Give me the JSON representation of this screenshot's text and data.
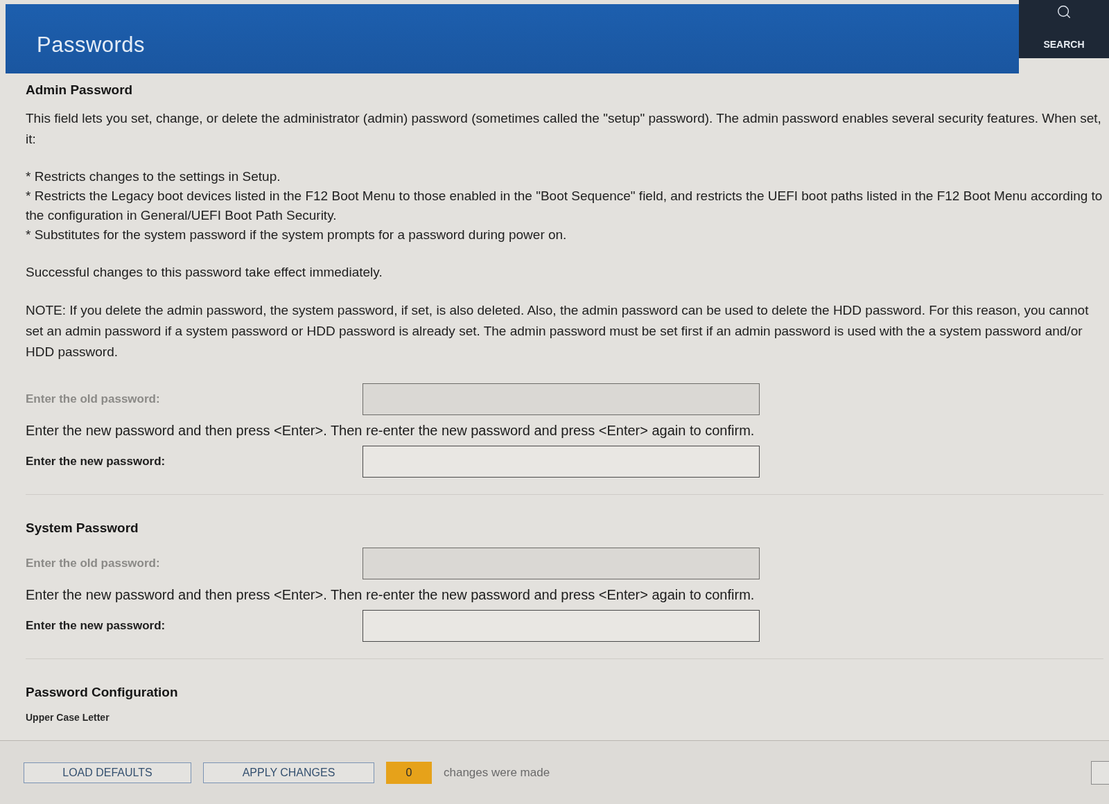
{
  "header": {
    "title": "Passwords",
    "search_label": "SEARCH"
  },
  "sections": [
    {
      "heading": "Admin Password",
      "blocks": [
        {
          "kind": "paragraph",
          "text": "This field lets you set, change, or delete the administrator (admin) password (sometimes called the \"setup\" password). The admin password enables several security features. When set, it:"
        },
        {
          "kind": "bullets",
          "items": [
            "* Restricts changes to the settings in Setup.",
            "* Restricts the Legacy boot devices listed in the F12 Boot Menu to those enabled in the \"Boot Sequence\" field, and restricts the UEFI boot paths listed in the F12 Boot Menu according to the configuration in General/UEFI Boot Path Security.",
            "* Substitutes for the system password if the system prompts for a password during power on."
          ]
        },
        {
          "kind": "paragraph",
          "text": "Successful changes to this password take effect immediately."
        },
        {
          "kind": "paragraph",
          "text": "NOTE: If you delete the admin password, the system password, if set, is also deleted. Also, the admin password can be used to delete the HDD password. For this reason, you cannot set an admin password if a system password or HDD password is already set. The admin password must be set first if an admin password is used with the a system password and/or HDD password."
        },
        {
          "kind": "field",
          "label": "Enter the old password:",
          "disabled": true
        },
        {
          "kind": "instruction",
          "text": "Enter the new password and then press <Enter>. Then re-enter the new password and press <Enter> again to confirm."
        },
        {
          "kind": "field",
          "label": "Enter the new password:",
          "disabled": false
        }
      ]
    },
    {
      "heading": "System Password",
      "blocks": [
        {
          "kind": "field",
          "label": "Enter the old password:",
          "disabled": true
        },
        {
          "kind": "instruction",
          "text": "Enter the new password and then press <Enter>. Then re-enter the new password and press <Enter> again to confirm."
        },
        {
          "kind": "field",
          "label": "Enter the new password:",
          "disabled": false
        }
      ]
    },
    {
      "heading": "Password Configuration",
      "blocks": [
        {
          "kind": "subheading",
          "text": "Upper Case Letter"
        }
      ]
    }
  ],
  "footer": {
    "buttons": [
      {
        "label": "LOAD DEFAULTS"
      },
      {
        "label": "APPLY CHANGES"
      }
    ],
    "change_count": "0",
    "change_text": "changes were made"
  }
}
